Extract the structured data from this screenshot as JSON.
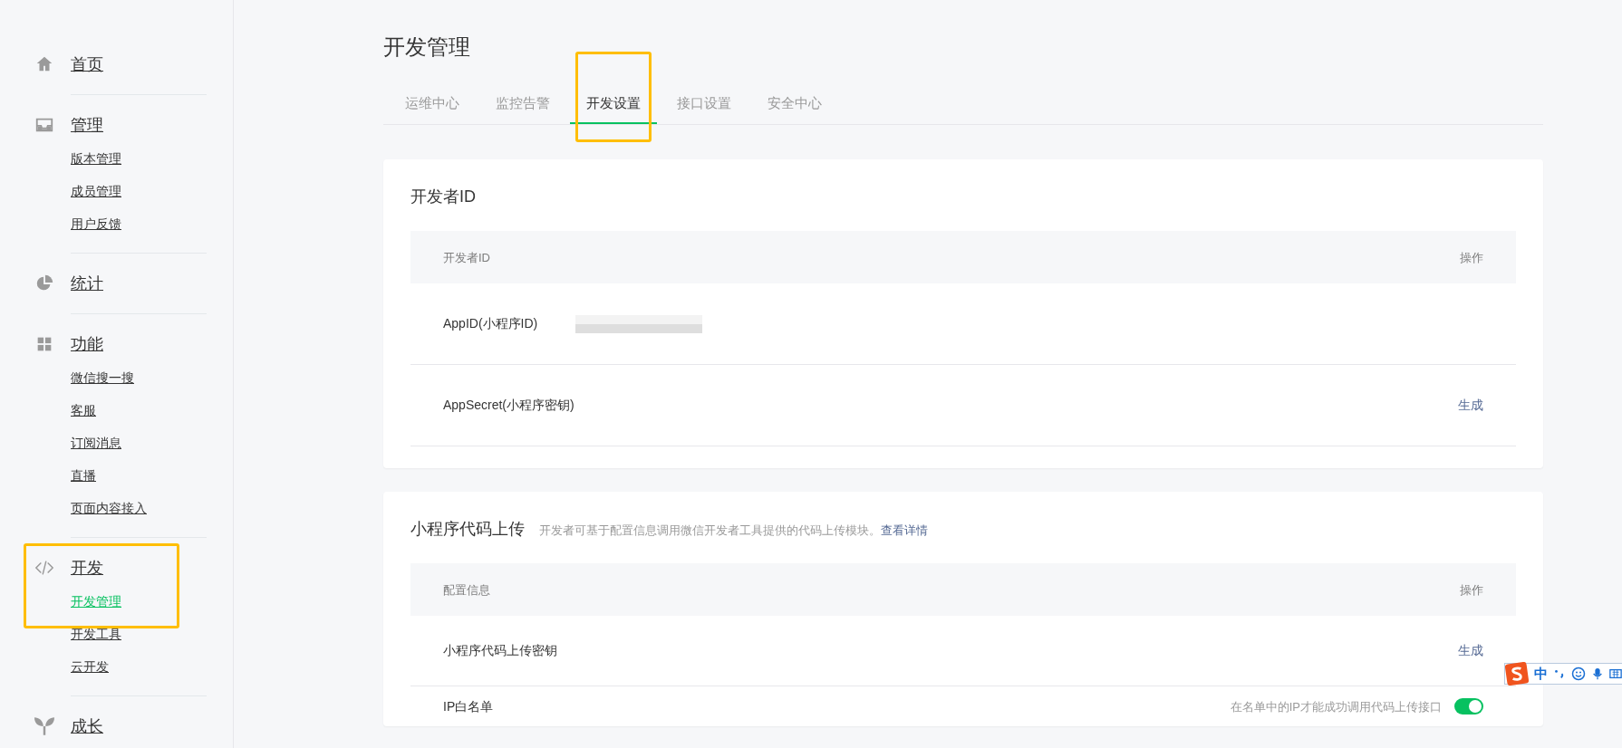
{
  "sidebar": {
    "groups": [
      {
        "label": "首页"
      },
      {
        "label": "管理",
        "items": [
          {
            "label": "版本管理",
            "selected": false
          },
          {
            "label": "成员管理",
            "selected": false
          },
          {
            "label": "用户反馈",
            "selected": false
          }
        ]
      },
      {
        "label": "统计"
      },
      {
        "label": "功能",
        "items": [
          {
            "label": "微信搜一搜",
            "selected": false
          },
          {
            "label": "客服",
            "selected": false
          },
          {
            "label": "订阅消息",
            "selected": false
          },
          {
            "label": "直播",
            "selected": false
          },
          {
            "label": "页面内容接入",
            "selected": false
          }
        ]
      },
      {
        "label": "开发",
        "highlighted": true,
        "items": [
          {
            "label": "开发管理",
            "selected": true
          },
          {
            "label": "开发工具",
            "selected": false
          },
          {
            "label": "云开发",
            "selected": false
          }
        ]
      },
      {
        "label": "成长"
      }
    ]
  },
  "page_title": "开发管理",
  "tabs": [
    {
      "label": "运维中心",
      "selected": false
    },
    {
      "label": "监控告警",
      "selected": false
    },
    {
      "label": "开发设置",
      "selected": true,
      "highlighted": true
    },
    {
      "label": "接口设置",
      "selected": false
    },
    {
      "label": "安全中心",
      "selected": false
    }
  ],
  "sections": [
    {
      "title": "开发者ID",
      "columns": [
        "开发者ID",
        "操作"
      ],
      "rows": [
        {
          "kind": "blurred",
          "label": "AppID(小程序ID)"
        },
        {
          "kind": "action",
          "label": "AppSecret(小程序密钥)",
          "action": "生成"
        }
      ]
    },
    {
      "title": "小程序代码上传",
      "description": "开发者可基于配置信息调用微信开发者工具提供的代码上传模块。",
      "link": "查看详情",
      "columns": [
        "配置信息",
        "操作"
      ],
      "rows": [
        {
          "kind": "action",
          "label": "小程序代码上传密钥",
          "action": "生成"
        },
        {
          "kind": "toggle",
          "label": "IP白名单",
          "hint": "在名单中的IP才能成功调用代码上传接口",
          "on": true
        }
      ]
    }
  ],
  "ime_toolbar": {
    "mode": "中"
  }
}
